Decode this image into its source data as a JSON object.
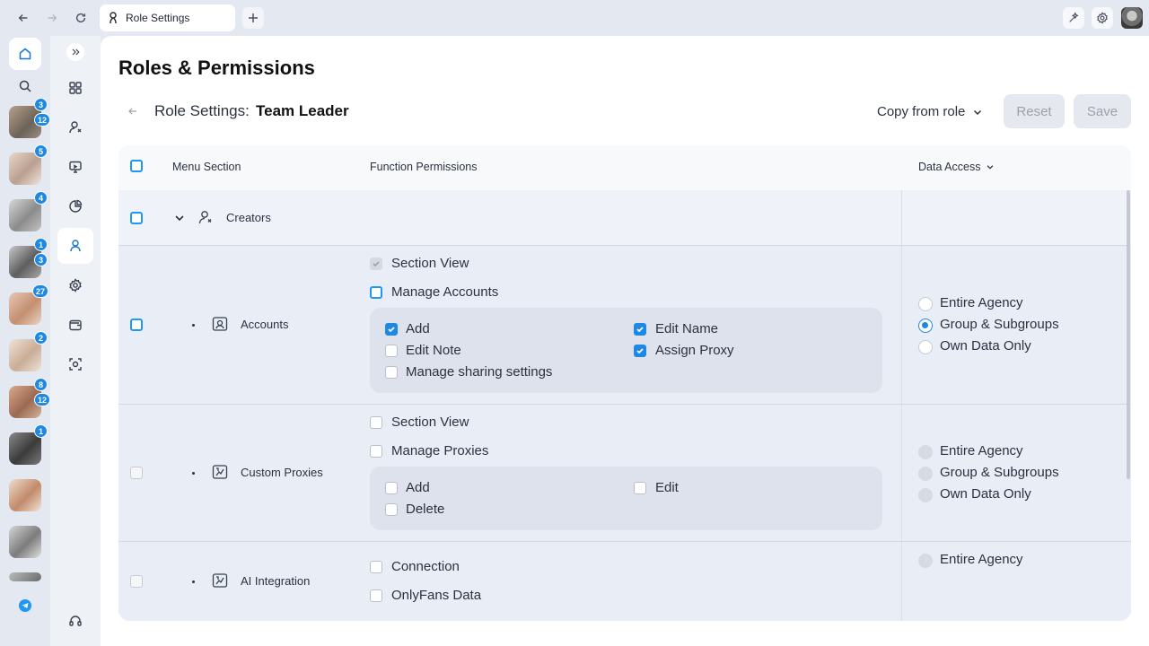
{
  "browser": {
    "tab_title": "Role Settings",
    "icons": [
      "back-arrow-icon",
      "forward-arrow-icon",
      "reload-icon",
      "new-tab-plus-icon",
      "sparkle-icon",
      "settings-icon"
    ]
  },
  "creator_strip": {
    "badges": [
      {
        "top": "3",
        "bottom": "12"
      },
      {
        "top": "5",
        "bottom": ""
      },
      {
        "top": "4",
        "bottom": ""
      },
      {
        "top": "1",
        "bottom": "3"
      },
      {
        "top": "27",
        "bottom": ""
      },
      {
        "top": "2",
        "bottom": ""
      },
      {
        "top": "8",
        "bottom": "12"
      },
      {
        "top": "1",
        "bottom": ""
      },
      {
        "top": "",
        "bottom": ""
      },
      {
        "top": "",
        "bottom": ""
      }
    ]
  },
  "page": {
    "title": "Roles & Permissions",
    "role_label": "Role Settings:",
    "role_name": "Team Leader",
    "copy_from_role": "Copy from role",
    "reset": "Reset",
    "save": "Save"
  },
  "table": {
    "headers": {
      "menu_section": "Menu Section",
      "function_permissions": "Function Permissions",
      "data_access": "Data Access"
    },
    "group": {
      "name": "Creators"
    },
    "accounts": {
      "name": "Accounts",
      "section_view": "Section View",
      "manage": "Manage Accounts",
      "perms": {
        "add": "Add",
        "edit_name": "Edit Name",
        "edit_note": "Edit Note",
        "assign_proxy": "Assign Proxy",
        "sharing": "Manage sharing settings"
      },
      "data_access": {
        "entire": "Entire Agency",
        "group": "Group & Subgroups",
        "own": "Own Data Only",
        "selected": "Group & Subgroups"
      }
    },
    "proxies": {
      "name": "Custom Proxies",
      "section_view": "Section View",
      "manage": "Manage Proxies",
      "perms": {
        "add": "Add",
        "edit": "Edit",
        "delete": "Delete"
      },
      "data_access": {
        "entire": "Entire Agency",
        "group": "Group & Subgroups",
        "own": "Own Data Only"
      }
    },
    "ai": {
      "name": "AI Integration",
      "connection": "Connection",
      "onlyfans": "OnlyFans Data",
      "data_access": {
        "entire": "Entire Agency"
      }
    }
  },
  "colors": {
    "accent": "#1e88e5",
    "background": "#e4e9f1"
  }
}
